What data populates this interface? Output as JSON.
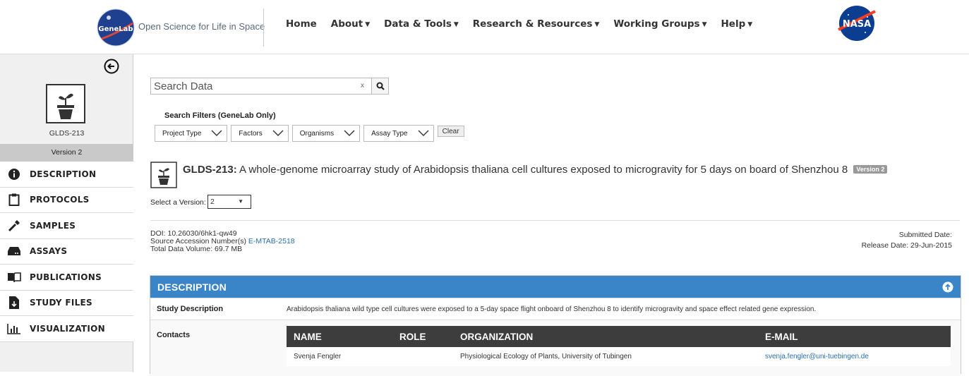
{
  "header": {
    "logo_text": "GeneLab",
    "tagline": "Open Science for Life in Space",
    "nav": [
      {
        "label": "Home",
        "has_dropdown": false
      },
      {
        "label": "About",
        "has_dropdown": true
      },
      {
        "label": "Data & Tools",
        "has_dropdown": true
      },
      {
        "label": "Research & Resources",
        "has_dropdown": true
      },
      {
        "label": "Working Groups",
        "has_dropdown": true
      },
      {
        "label": "Help",
        "has_dropdown": true
      }
    ],
    "nasa_logo_text": "NASA"
  },
  "sidebar": {
    "study_id": "GLDS-213",
    "version": "Version 2",
    "items": [
      {
        "label": "DESCRIPTION",
        "icon": "info-icon"
      },
      {
        "label": "PROTOCOLS",
        "icon": "clipboard-icon"
      },
      {
        "label": "SAMPLES",
        "icon": "pipette-icon"
      },
      {
        "label": "ASSAYS",
        "icon": "hard-drive-icon"
      },
      {
        "label": "PUBLICATIONS",
        "icon": "book-icon"
      },
      {
        "label": "STUDY FILES",
        "icon": "file-download-icon"
      },
      {
        "label": "VISUALIZATION",
        "icon": "bar-chart-icon"
      }
    ]
  },
  "search": {
    "placeholder": "Search Data",
    "clear_label": "x",
    "filters_title": "Search Filters (GeneLab Only)",
    "filters": [
      "Project Type",
      "Factors",
      "Organisms",
      "Assay Type"
    ],
    "clear_button": "Clear"
  },
  "study": {
    "id_prefix": "GLDS-213:",
    "title": "A whole-genome microarray study of Arabidopsis thaliana cell cultures exposed to microgravity for 5 days on board of Shenzhou 8",
    "version_badge": "Version 2",
    "select_version_label": "Select a Version:",
    "selected_version": "2",
    "doi": "DOI: 10.26030/6hk1-qw49",
    "source_accession_label": "Source Accession Number(s)",
    "source_accession_value": "E-MTAB-2518",
    "total_volume": "Total Data Volume: 69.7 MB",
    "submitted_date": "Submitted Date:",
    "release_date": "Release Date: 29-Jun-2015"
  },
  "description": {
    "heading": "DESCRIPTION",
    "study_description_label": "Study Description",
    "study_description": "Arabidopsis thaliana wild type cell cultures were exposed to a 5-day space flight onboard of Shenzhou 8 to identify microgravity and space effect related gene expression.",
    "contacts_label": "Contacts",
    "contacts_columns": [
      "NAME",
      "ROLE",
      "ORGANIZATION",
      "E-MAIL"
    ],
    "contacts": [
      {
        "name": "Svenja Fengler",
        "role": "",
        "organization": "Physiological Ecology of Plants, University of Tubingen",
        "email": "svenja.fengler@uni-tuebingen.de"
      }
    ]
  },
  "colors": {
    "panel_header": "#3a85c7",
    "table_header": "#3d3d3d",
    "link": "#2a6fb0",
    "sidebar_bg": "#f0f0f0"
  }
}
